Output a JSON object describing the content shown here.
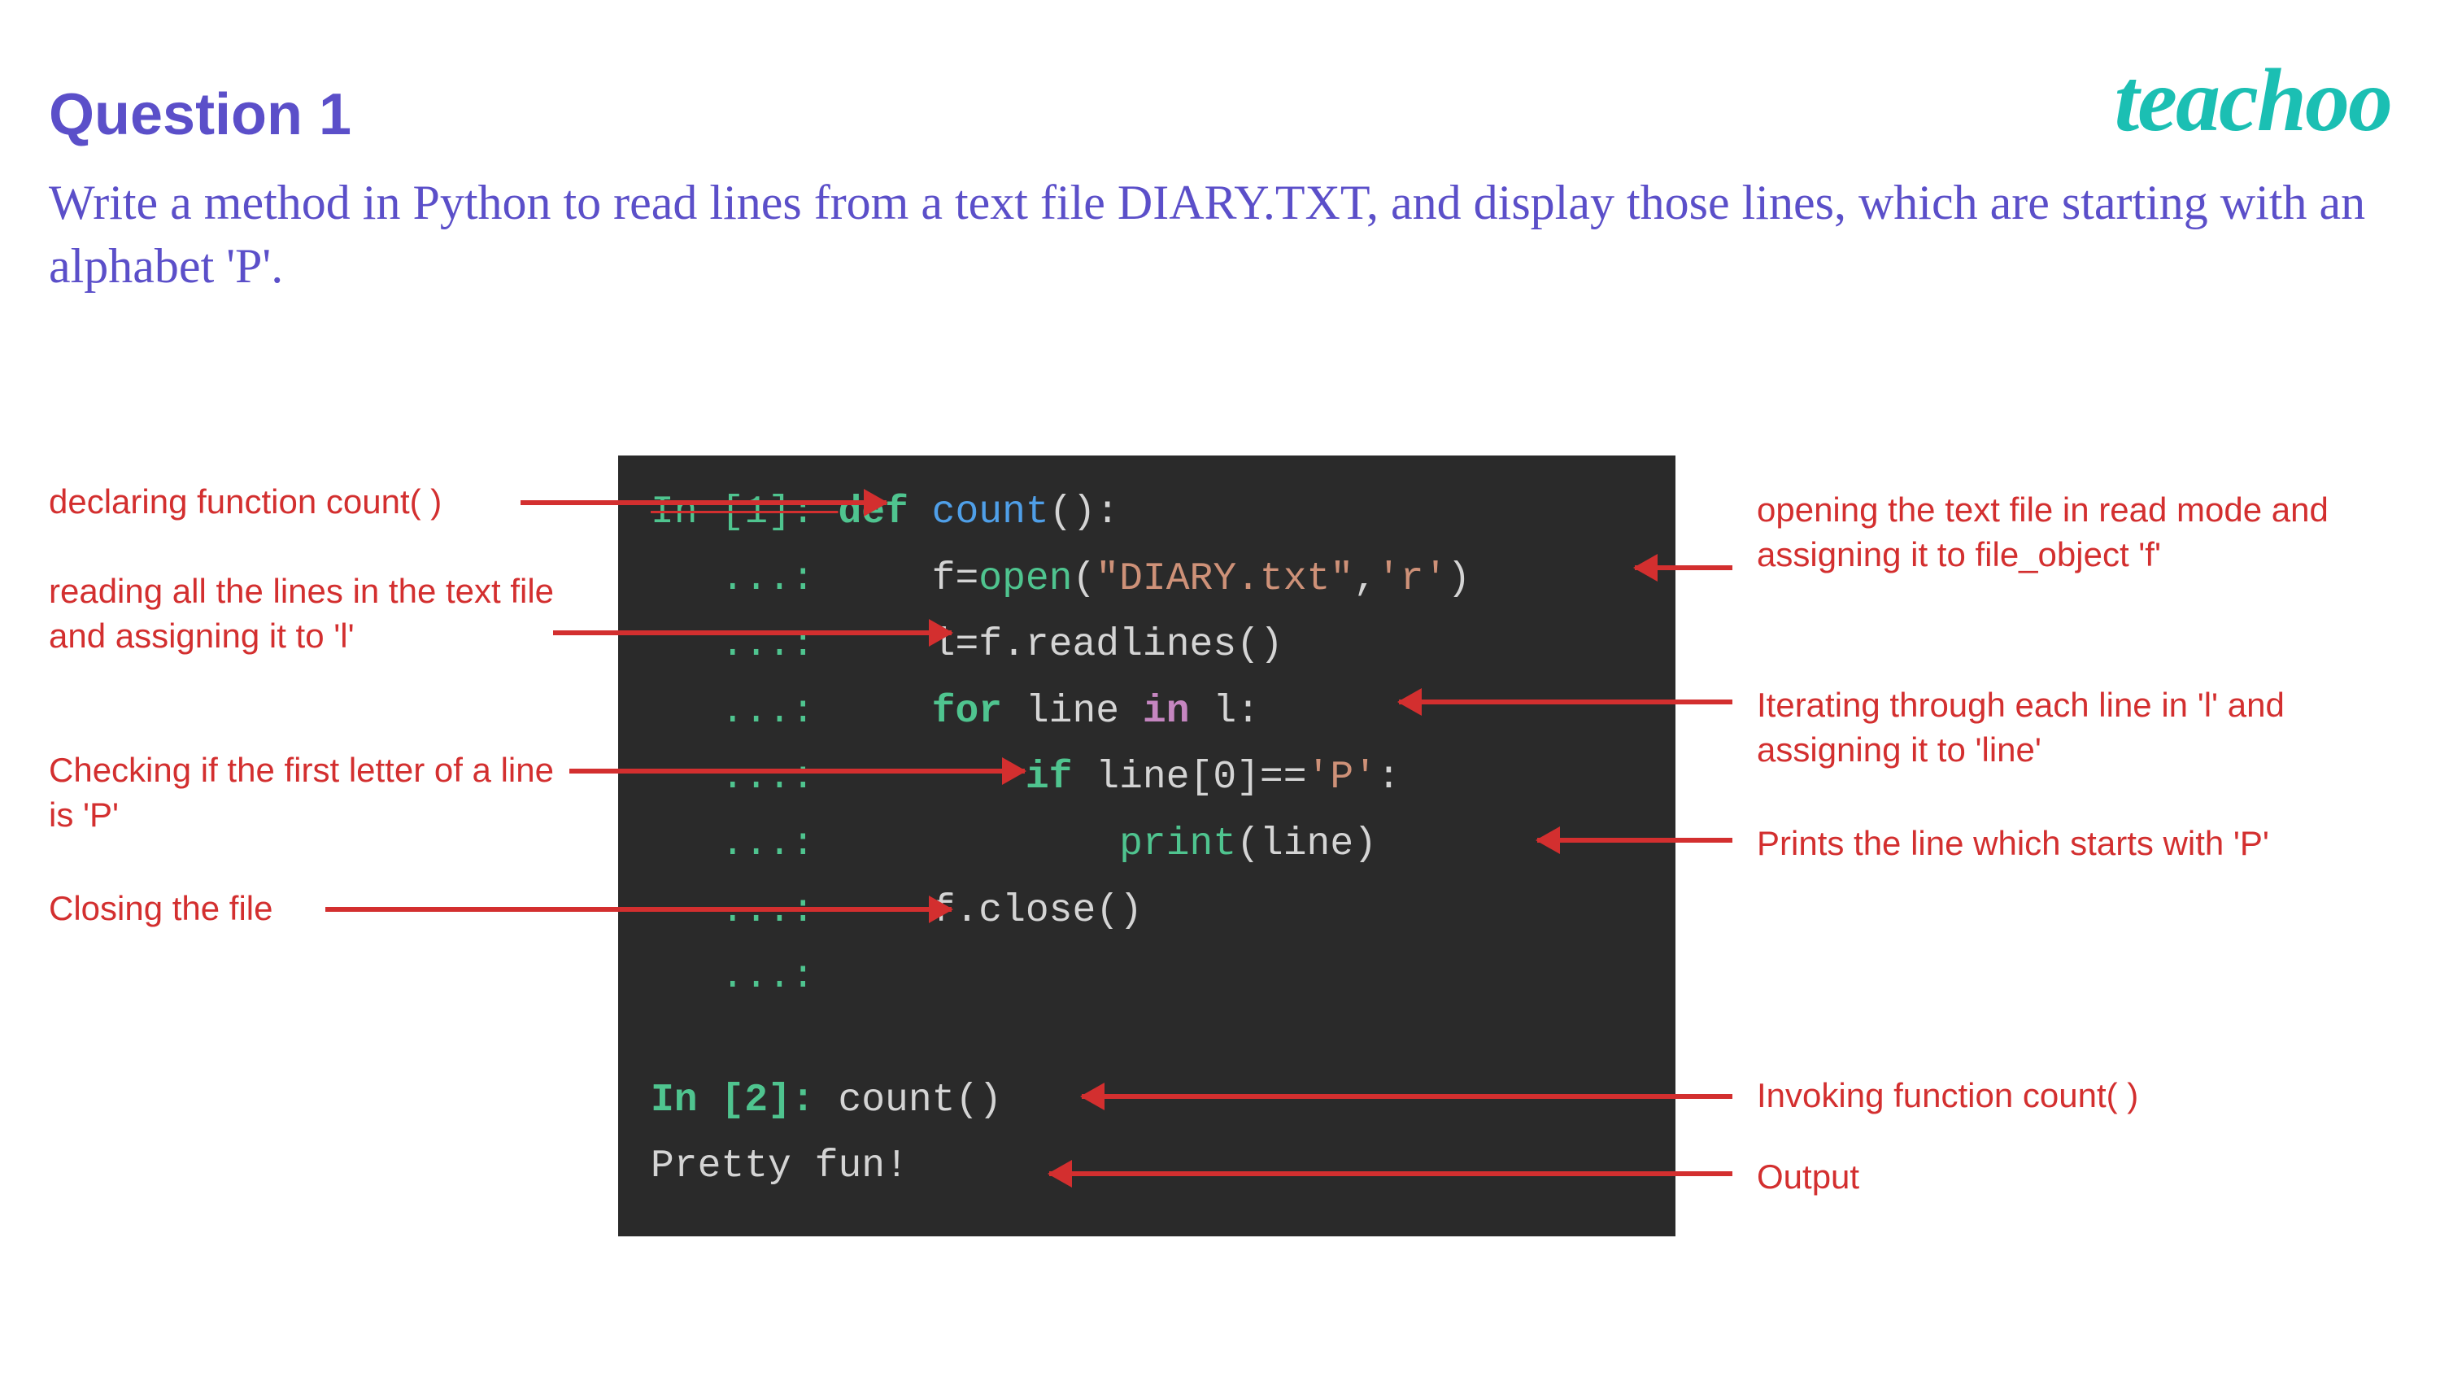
{
  "heading": "Question 1",
  "question": "Write a method in Python to read lines from a text  file DIARY.TXT, and display those lines, which  are starting with an alphabet 'P'.",
  "logo": "teachoo",
  "code": {
    "l1_prompt": "In [1]: ",
    "l1_def": "def ",
    "l1_fn": "count",
    "l1_rest": "():",
    "dots": "   ...: ",
    "l2_var": "f=",
    "l2_open": "open",
    "l2_p1": "(",
    "l2_s1": "\"DIARY.txt\"",
    "l2_c": ",",
    "l2_s2": "'r'",
    "l2_p2": ")",
    "l3": "l=f.readlines()",
    "l4_for": "for ",
    "l4_var": "line ",
    "l4_in": "in ",
    "l4_l": "l:",
    "l5_if": "if ",
    "l5_r": "line[0]==",
    "l5_s": "'P'",
    "l5_c": ":",
    "l6_print": "print",
    "l6_r": "(line)",
    "l7": "f.close()",
    "l9_prompt": "In [2]: ",
    "l9_call": "count()",
    "l10": "Pretty fun!"
  },
  "annotations": {
    "left1": "declaring function count( )",
    "left2": "reading all the lines in the text file and assigning it to 'l'",
    "left3": "Checking if the first letter of a line is 'P'",
    "left4": "Closing the file",
    "right1": "opening the text file in read mode and assigning it to file_object 'f'",
    "right2": "Iterating through each line in 'l' and assigning it to 'line'",
    "right3": "Prints the line which starts with 'P'",
    "right4": "Invoking function count( )",
    "right5": "Output"
  }
}
